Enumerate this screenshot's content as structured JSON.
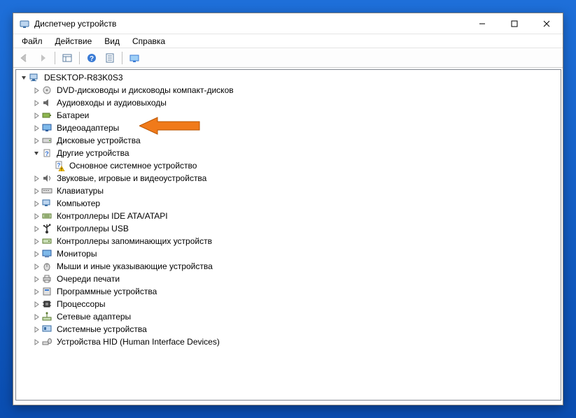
{
  "window": {
    "title": "Диспетчер устройств"
  },
  "menubar": {
    "file": "Файл",
    "action": "Действие",
    "view": "Вид",
    "help": "Справка"
  },
  "tree": {
    "root": "DESKTOP-R83K0S3",
    "nodes": [
      {
        "label": "DVD-дисководы и дисководы компакт-дисков",
        "icon": "disc"
      },
      {
        "label": "Аудиовходы и аудиовыходы",
        "icon": "audio"
      },
      {
        "label": "Батареи",
        "icon": "battery"
      },
      {
        "label": "Видеоадаптеры",
        "icon": "display",
        "highlight": true
      },
      {
        "label": "Дисковые устройства",
        "icon": "drive"
      },
      {
        "label": "Другие устройства",
        "icon": "unknown",
        "expanded": true,
        "children": [
          {
            "label": "Основное системное устройство",
            "icon": "unknown-warn"
          }
        ]
      },
      {
        "label": "Звуковые, игровые и видеоустройства",
        "icon": "sound"
      },
      {
        "label": "Клавиатуры",
        "icon": "keyboard"
      },
      {
        "label": "Компьютер",
        "icon": "computer"
      },
      {
        "label": "Контроллеры IDE ATA/ATAPI",
        "icon": "ide"
      },
      {
        "label": "Контроллеры USB",
        "icon": "usb"
      },
      {
        "label": "Контроллеры запоминающих устройств",
        "icon": "storage"
      },
      {
        "label": "Мониторы",
        "icon": "monitor"
      },
      {
        "label": "Мыши и иные указывающие устройства",
        "icon": "mouse"
      },
      {
        "label": "Очереди печати",
        "icon": "printer"
      },
      {
        "label": "Программные устройства",
        "icon": "software"
      },
      {
        "label": "Процессоры",
        "icon": "cpu"
      },
      {
        "label": "Сетевые адаптеры",
        "icon": "network"
      },
      {
        "label": "Системные устройства",
        "icon": "system"
      },
      {
        "label": "Устройства HID (Human Interface Devices)",
        "icon": "hid"
      }
    ]
  }
}
